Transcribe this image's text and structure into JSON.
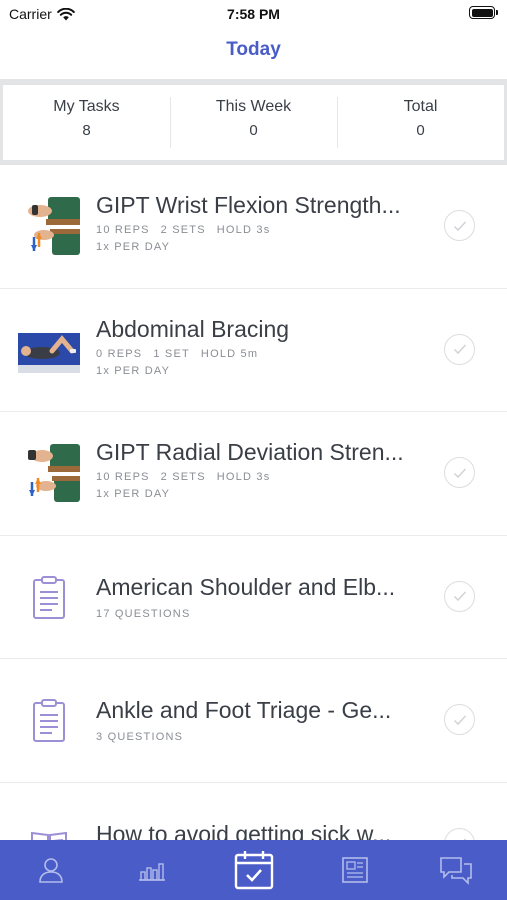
{
  "status_bar": {
    "carrier": "Carrier",
    "time": "7:58 PM"
  },
  "header": {
    "title": "Today"
  },
  "stats": [
    {
      "label": "My Tasks",
      "value": "8"
    },
    {
      "label": "This Week",
      "value": "0"
    },
    {
      "label": "Total",
      "value": "0"
    }
  ],
  "tasks": [
    {
      "title": "GIPT Wrist Flexion Strength...",
      "reps": "10 REPS",
      "sets": "2 SETS",
      "hold": "HOLD 3s",
      "frequency": "1x PER DAY",
      "icon": "wrist-flexion-thumbnail"
    },
    {
      "title": "Abdominal Bracing",
      "reps": "0 REPS",
      "sets": "1 SET",
      "hold": "HOLD 5m",
      "frequency": "1x PER DAY",
      "icon": "abdominal-bracing-thumbnail"
    },
    {
      "title": "GIPT Radial Deviation Stren...",
      "reps": "10 REPS",
      "sets": "2 SETS",
      "hold": "HOLD 3s",
      "frequency": "1x PER DAY",
      "icon": "radial-deviation-thumbnail"
    },
    {
      "title": "American Shoulder and Elb...",
      "questions": "17 QUESTIONS",
      "icon": "clipboard-icon"
    },
    {
      "title": "Ankle and Foot Triage - Ge...",
      "questions": "3 QUESTIONS",
      "icon": "clipboard-icon"
    },
    {
      "title": "How to avoid getting sick w...",
      "icon": "book-icon"
    }
  ],
  "tab_bar": {
    "items": [
      "profile-icon",
      "progress-chart-icon",
      "calendar-check-icon",
      "education-icon",
      "messages-icon"
    ],
    "active": "calendar-check-icon"
  },
  "colors": {
    "accent": "#4a5cc8",
    "survey_icon": "#9d8fd6",
    "check": "#dcdde0"
  }
}
